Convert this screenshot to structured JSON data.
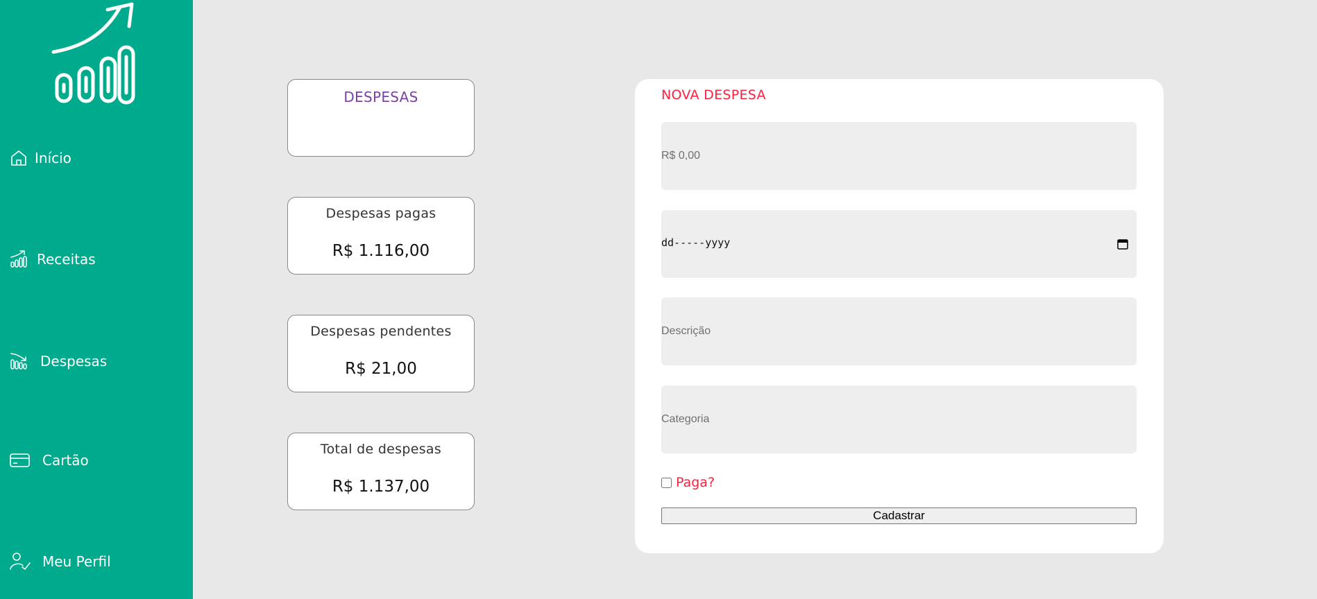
{
  "sidebar": {
    "logo_icon": "growth-chart-icon",
    "accent_color": "#00aa8d",
    "items": [
      {
        "label": "Início",
        "icon": "home-icon"
      },
      {
        "label": "Receitas",
        "icon": "chart-up-icon"
      },
      {
        "label": "Despesas",
        "icon": "chart-down-icon"
      },
      {
        "label": "Cartão",
        "icon": "credit-card-icon"
      },
      {
        "label": "Meu Perfil",
        "icon": "user-check-icon"
      }
    ]
  },
  "summary": {
    "header": "DESPESAS",
    "cards": [
      {
        "title": "Despesas pagas",
        "value": "R$ 1.116,00"
      },
      {
        "title": "Despesas pendentes",
        "value": "R$ 21,00"
      },
      {
        "title": "Total de despesas",
        "value": "R$ 1.137,00"
      }
    ]
  },
  "form": {
    "title": "NOVA DESPESA",
    "amount_placeholder": "R$ 0,00",
    "date_placeholder": "dd-----yyyy",
    "description_placeholder": "Descrição",
    "category_placeholder": "Categoria",
    "paid_label": "Paga?",
    "submit_label": "Cadastrar",
    "title_color": "#ff1f3d"
  }
}
